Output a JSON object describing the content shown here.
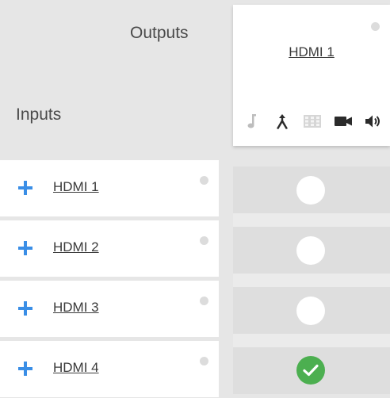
{
  "header": {
    "outputs_label": "Outputs",
    "inputs_label": "Inputs"
  },
  "output": {
    "name": "HDMI 1",
    "icons": [
      "music-note-icon",
      "merge-arrow-icon",
      "grid-icon",
      "video-camera-icon",
      "speaker-icon"
    ]
  },
  "inputs": [
    {
      "name": "HDMI 1",
      "routed": false
    },
    {
      "name": "HDMI 2",
      "routed": false
    },
    {
      "name": "HDMI 3",
      "routed": false
    },
    {
      "name": "HDMI 4",
      "routed": true
    }
  ],
  "colors": {
    "accent": "#3a8ee6",
    "routed": "#4caf50",
    "status_dot": "#dcdcdc"
  }
}
